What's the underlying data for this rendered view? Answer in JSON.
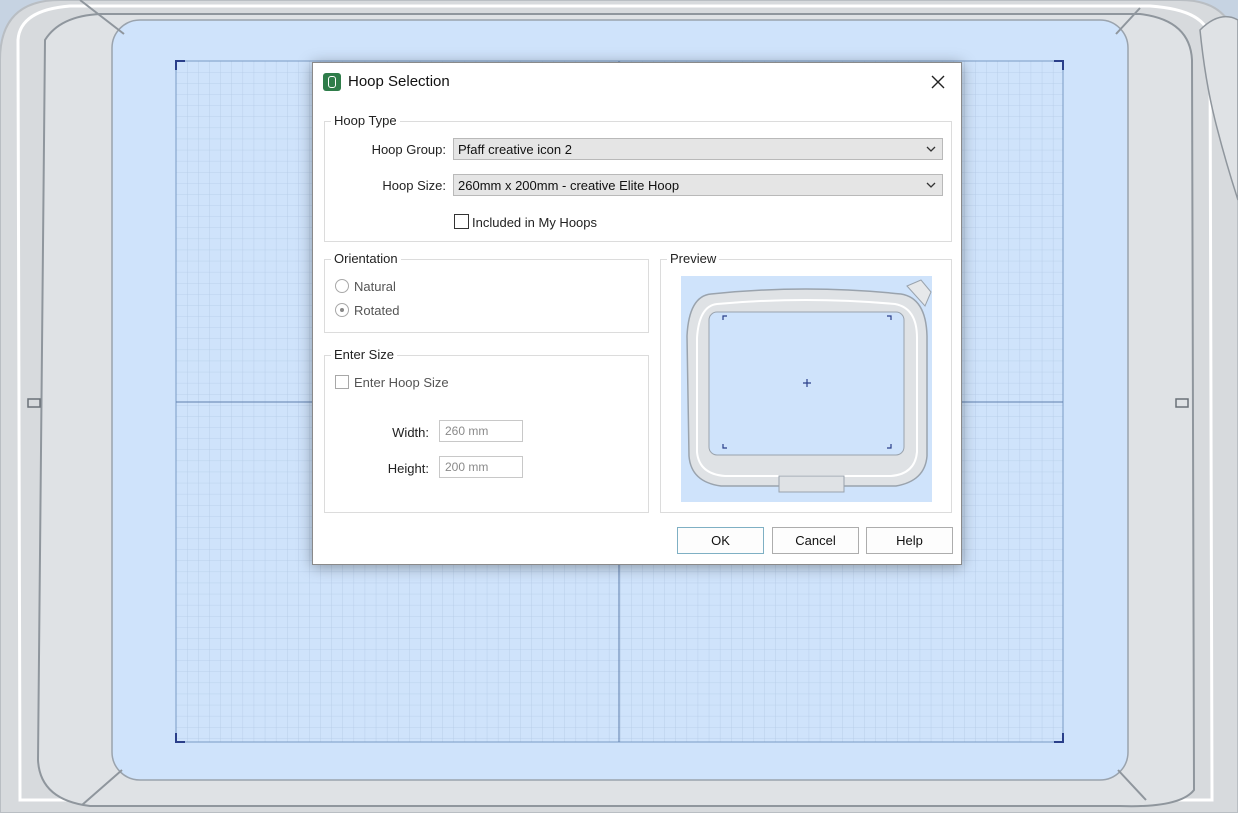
{
  "dialog": {
    "title": "Hoop Selection",
    "hoop_type": {
      "legend": "Hoop Type",
      "group_label": "Hoop Group:",
      "group_value": "Pfaff creative icon 2",
      "size_label": "Hoop Size:",
      "size_value": "260mm x 200mm - creative Elite Hoop",
      "included_label": "Included in My Hoops",
      "included_checked": false
    },
    "orientation": {
      "legend": "Orientation",
      "options": [
        {
          "label": "Natural",
          "selected": false
        },
        {
          "label": "Rotated",
          "selected": true
        }
      ]
    },
    "enter_size": {
      "legend": "Enter Size",
      "checkbox_label": "Enter Hoop Size",
      "checked": false,
      "width_label": "Width:",
      "width_value": "260 mm",
      "height_label": "Height:",
      "height_value": "200 mm"
    },
    "preview": {
      "legend": "Preview"
    },
    "buttons": {
      "ok": "OK",
      "cancel": "Cancel",
      "help": "Help"
    }
  },
  "colors": {
    "hoop_field": "#cfe3fb",
    "grid_line": "#a9c3e0",
    "hoop_frame": "#dcdfe2",
    "accent_green": "#2f7d4a"
  }
}
